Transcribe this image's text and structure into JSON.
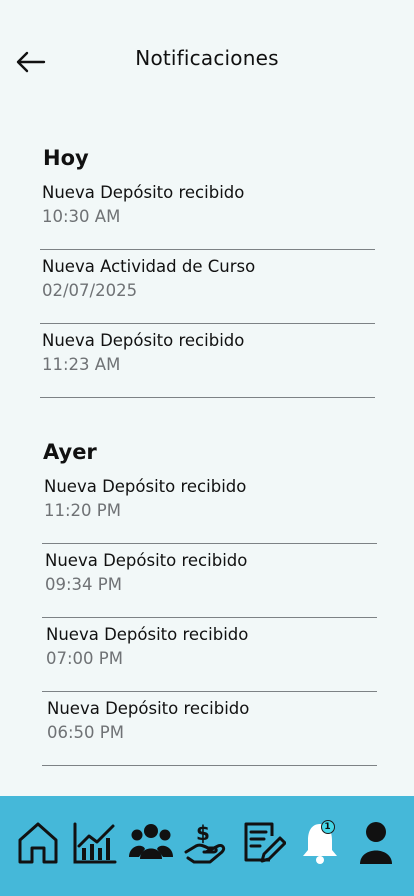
{
  "header": {
    "title": "Notificaciones",
    "back_icon": "arrow-left-icon"
  },
  "sections": [
    {
      "title": "Hoy",
      "items": [
        {
          "title": "Nueva Depósito recibido",
          "time": "10:30 AM"
        },
        {
          "title": "Nueva Actividad de Curso",
          "time": "02/07/2025"
        },
        {
          "title": "Nueva Depósito recibido",
          "time": "11:23 AM"
        }
      ]
    },
    {
      "title": "Ayer",
      "items": [
        {
          "title": "Nueva Depósito recibido",
          "time": "11:20 PM"
        },
        {
          "title": "Nueva Depósito recibido",
          "time": "09:34 PM"
        },
        {
          "title": "Nueva Depósito recibido",
          "time": "07:00 PM"
        },
        {
          "title": "Nueva Depósito recibido",
          "time": "06:50 PM"
        }
      ]
    }
  ],
  "navbar": {
    "background": "#45b8d9",
    "items": [
      {
        "icon": "home-icon"
      },
      {
        "icon": "chart-icon"
      },
      {
        "icon": "users-icon"
      },
      {
        "icon": "money-hand-icon"
      },
      {
        "icon": "edit-document-icon"
      },
      {
        "icon": "bell-icon",
        "badge": "1"
      },
      {
        "icon": "user-icon"
      }
    ]
  }
}
